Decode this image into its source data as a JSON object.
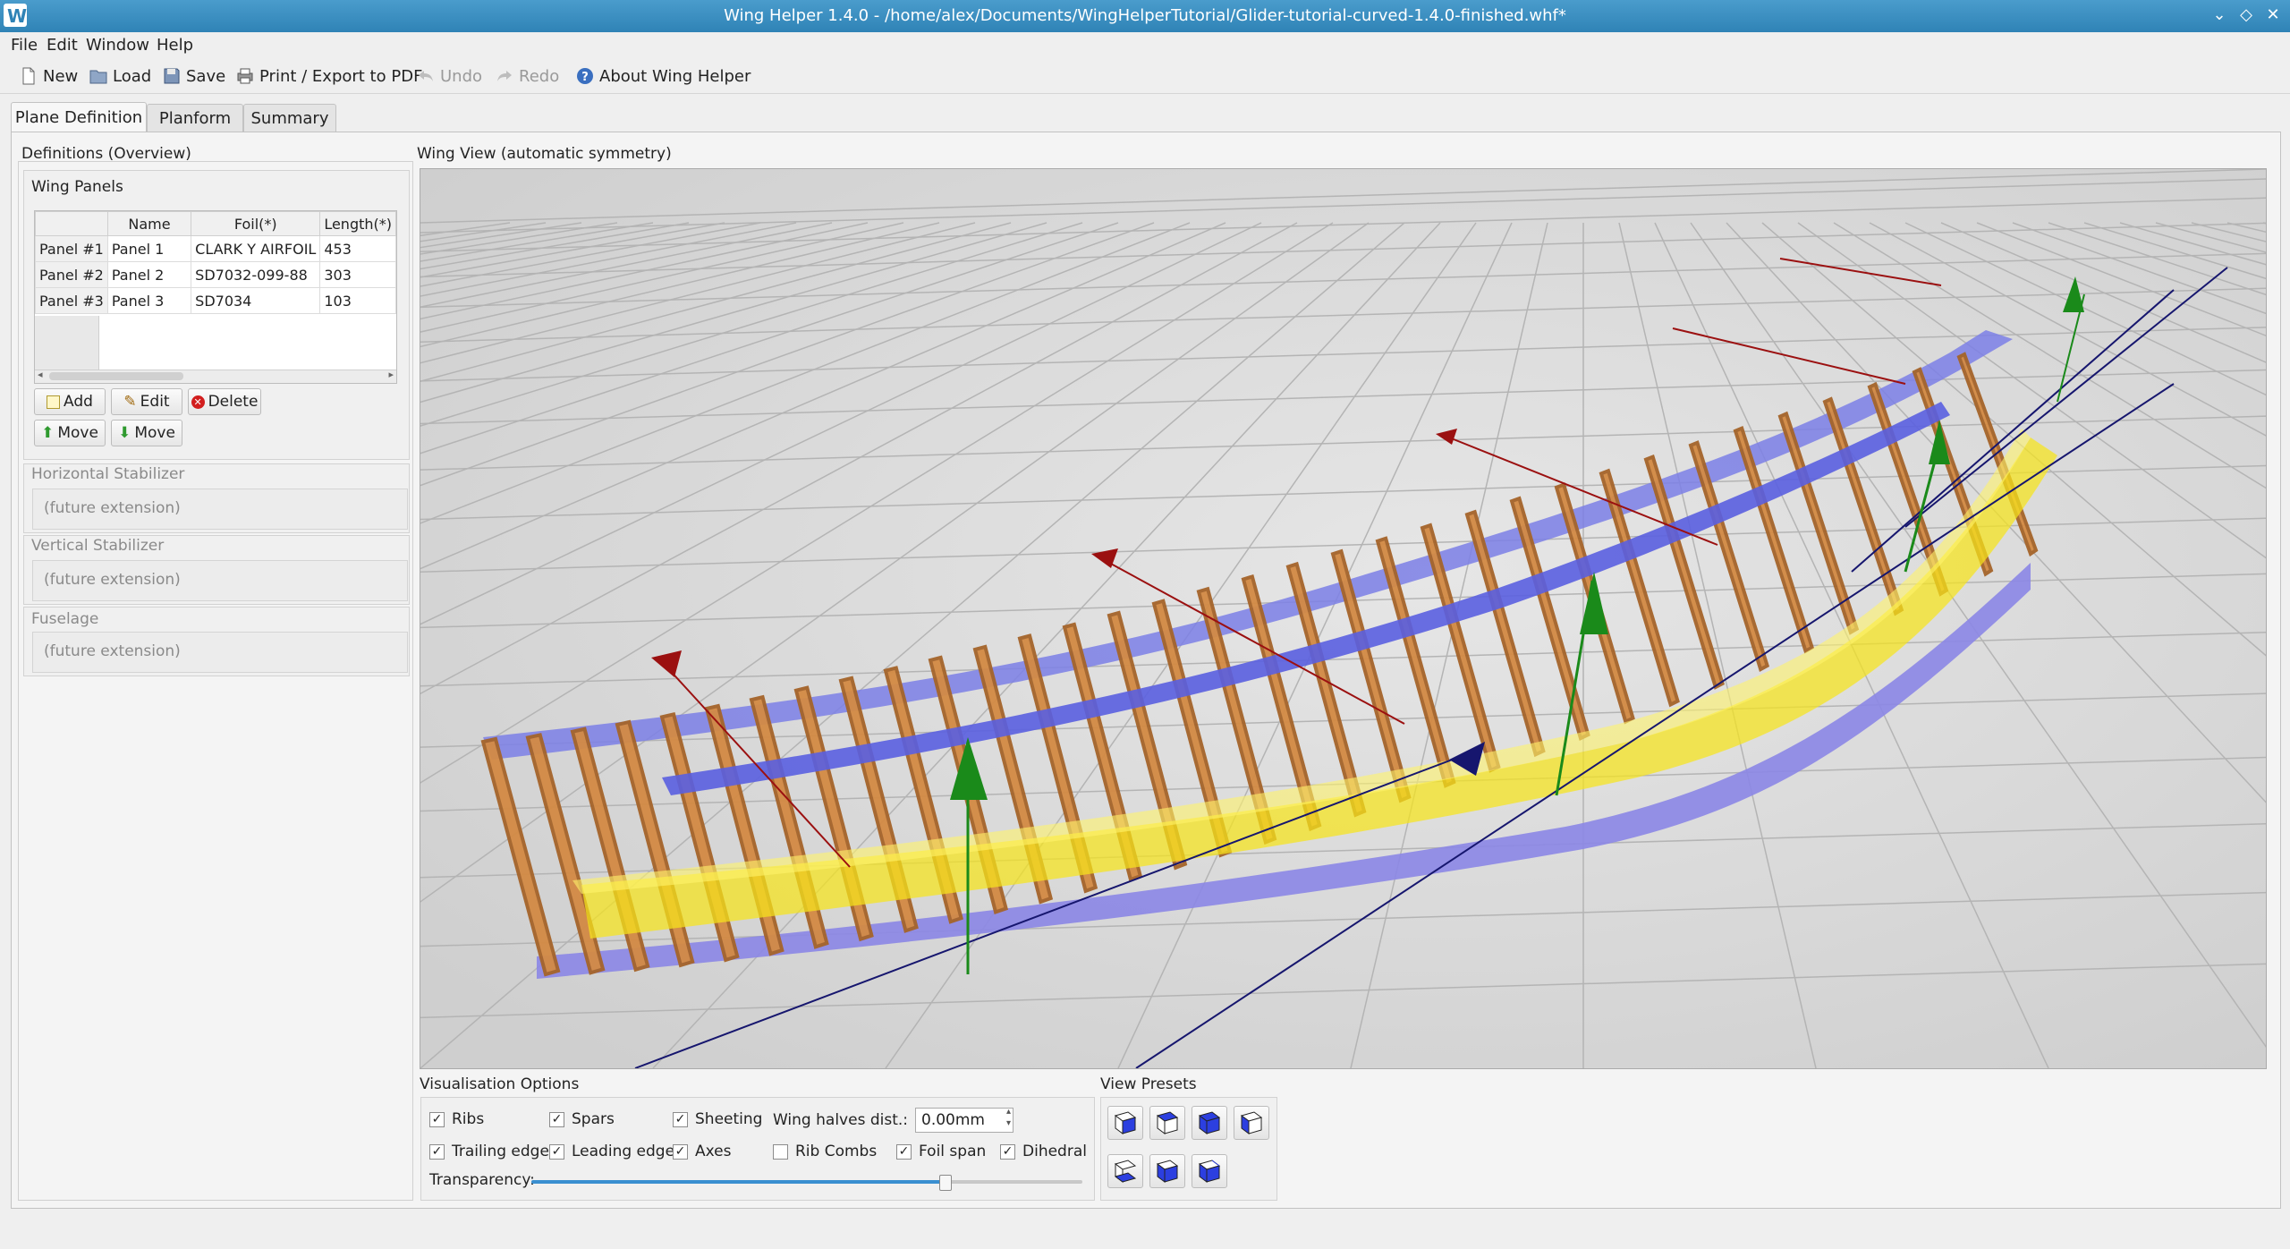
{
  "window": {
    "title": "Wing Helper 1.4.0 - /home/alex/Documents/WingHelperTutorial/Glider-tutorial-curved-1.4.0-finished.whf*",
    "controls": [
      "chevron-down-icon",
      "diamond-icon",
      "close-icon"
    ]
  },
  "menu": [
    "File",
    "Edit",
    "Window",
    "Help"
  ],
  "toolbar": {
    "new": "New",
    "load": "Load",
    "save": "Save",
    "print": "Print / Export to PDF",
    "undo": "Undo",
    "redo": "Redo",
    "about": "About Wing Helper"
  },
  "tabs": [
    "Plane Definition",
    "Planform",
    "Summary"
  ],
  "left": {
    "heading": "Definitions (Overview)",
    "wing_panels": {
      "title": "Wing Panels",
      "columns": [
        "Name",
        "Foil(*)",
        "Length(*)"
      ],
      "rows": [
        {
          "head": "Panel #1",
          "name": "Panel 1",
          "foil": "CLARK Y AIRFOIL",
          "length": "453"
        },
        {
          "head": "Panel #2",
          "name": "Panel 2",
          "foil": "SD7032-099-88",
          "length": "303"
        },
        {
          "head": "Panel #3",
          "name": "Panel 3",
          "foil": "SD7034",
          "length": "103"
        }
      ],
      "buttons": {
        "add": "Add",
        "edit": "Edit",
        "delete": "Delete",
        "move_up": "Move",
        "move_down": "Move"
      }
    },
    "hstab": {
      "title": "Horizontal Stabilizer",
      "content": "(future extension)"
    },
    "vstab": {
      "title": "Vertical Stabilizer",
      "content": "(future extension)"
    },
    "fuselage": {
      "title": "Fuselage",
      "content": "(future extension)"
    }
  },
  "wing_view": {
    "title": "Wing View (automatic symmetry)"
  },
  "vis": {
    "title": "Visualisation Options",
    "options": {
      "ribs": {
        "label": "Ribs",
        "checked": true
      },
      "spars": {
        "label": "Spars",
        "checked": true
      },
      "sheeting": {
        "label": "Sheeting",
        "checked": true
      },
      "trailing": {
        "label": "Trailing edge",
        "checked": true
      },
      "leading": {
        "label": "Leading edge",
        "checked": true
      },
      "axes": {
        "label": "Axes",
        "checked": true
      },
      "ribcombs": {
        "label": "Rib Combs",
        "checked": false
      },
      "foilspan": {
        "label": "Foil span",
        "checked": true
      },
      "dihedral": {
        "label": "Dihedral",
        "checked": true
      }
    },
    "halves_label": "Wing halves dist.:",
    "halves_value": "0.00mm",
    "transparency_label": "Transparency:",
    "transparency": 0.75
  },
  "presets": {
    "title": "View Presets"
  },
  "colors": {
    "accent": "#2f83b6",
    "wood": "#c8843e",
    "sheeting": "#f5e21c",
    "spar": "#6a6ee0",
    "axis_red": "#9b1010",
    "axis_green": "#1a8a1a",
    "axis_blue": "#16166e"
  }
}
